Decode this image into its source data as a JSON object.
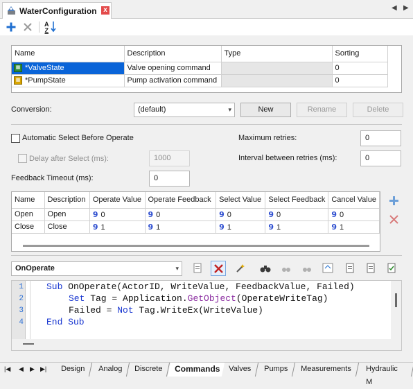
{
  "window": {
    "title": "WaterConfiguration",
    "close_glyph": "x",
    "nav_prev": "◀",
    "nav_next": "▶"
  },
  "toolbar": {
    "add_icon": "plus-icon",
    "delete_icon": "x-icon",
    "sort_icon": "sort-az-icon",
    "sort_label_a": "A",
    "sort_label_z": "Z"
  },
  "types_table": {
    "columns": [
      "Name",
      "Description",
      "Type",
      "Sorting"
    ],
    "rows": [
      {
        "name": "*ValveState",
        "description": "Valve opening command",
        "type": "",
        "sorting": "0"
      },
      {
        "name": "*PumpState",
        "description": "Pump activation command",
        "type": "",
        "sorting": "0"
      }
    ]
  },
  "conversion": {
    "label": "Conversion:",
    "value": "(default)",
    "new_label": "New",
    "rename_label": "Rename",
    "delete_label": "Delete"
  },
  "options": {
    "auto_select_label": "Automatic Select Before Operate",
    "delay_label": "Delay after Select (ms):",
    "delay_value": "1000",
    "feedback_timeout_label": "Feedback Timeout (ms):",
    "feedback_timeout_value": "0",
    "max_retries_label": "Maximum retries:",
    "max_retries_value": "0",
    "interval_label": "Interval between retries (ms):",
    "interval_value": "0"
  },
  "values_table": {
    "columns": [
      "Name",
      "Description",
      "Operate Value",
      "Operate Feedback",
      "Select Value",
      "Select Feedback",
      "Cancel Value"
    ],
    "rows": [
      {
        "name": "Open",
        "description": "Open",
        "operate_value": "0",
        "operate_feedback": "0",
        "select_value": "0",
        "select_feedback": "0",
        "cancel_value": "0"
      },
      {
        "name": "Close",
        "description": "Close",
        "operate_value": "1",
        "operate_feedback": "1",
        "select_value": "1",
        "select_feedback": "1",
        "cancel_value": "1"
      }
    ],
    "value_glyph": "9"
  },
  "script": {
    "event": "OnOperate",
    "lines": [
      {
        "num": "1",
        "text": "Sub OnOperate(ActorID, WriteValue, FeedbackValue, Failed)"
      },
      {
        "num": "2",
        "text": "Set Tag = Application.GetObject(OperateWriteTag)"
      },
      {
        "num": "3",
        "text": "Failed = Not Tag.WriteEx(WriteValue)"
      },
      {
        "num": "4",
        "text": "End Sub"
      }
    ],
    "line_parts": {
      "l1_kw": "Sub",
      "l1_rest": " OnOperate(ActorID, WriteValue, FeedbackValue, Failed)",
      "l2_kw": "Set",
      "l2_mid": " Tag = Application.",
      "l2_fn": "GetObject",
      "l2_rest": "(OperateWriteTag)",
      "l3_pre": "Failed = ",
      "l3_kw": "Not",
      "l3_rest": " Tag.WriteEx(WriteValue)",
      "l4_kw": "End Sub"
    }
  },
  "bottom_tabs": [
    "Design",
    "Analog",
    "Discrete",
    "Commands",
    "Valves",
    "Pumps",
    "Measurements",
    "Hydraulic M"
  ],
  "bottom_nav": [
    "|◀",
    "◀",
    "▶",
    "▶|"
  ],
  "active_tab": "Commands",
  "colors": {
    "selection": "#0a64d8",
    "keyword": "#1836d0",
    "function": "#8a2ca0",
    "value_glyph": "#2f4fd0",
    "close_button": "#e34a4a"
  }
}
